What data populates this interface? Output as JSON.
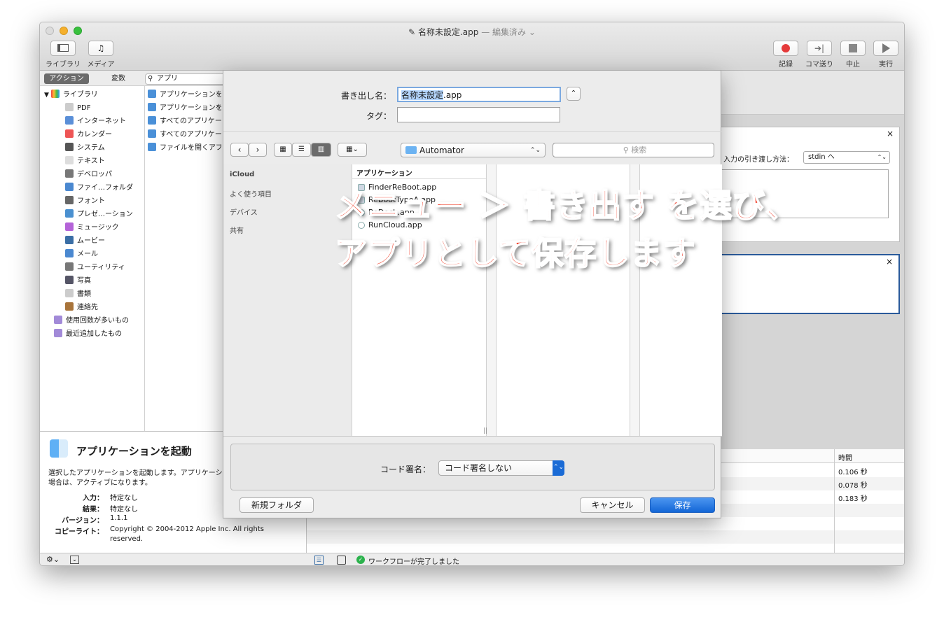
{
  "window": {
    "title": "名称未設定.app",
    "subtitle": "— 編集済み ⌄"
  },
  "toolbar": {
    "library": "ライブラリ",
    "media": "メディア",
    "record": "記録",
    "step": "コマ送り",
    "stop": "中止",
    "run": "実行"
  },
  "lib_tabs": {
    "actions": "アクション",
    "variables": "変数",
    "search": "アプリ"
  },
  "library": {
    "root": "ライブラリ",
    "items": [
      "PDF",
      "インターネット",
      "カレンダー",
      "システム",
      "テキスト",
      "デベロッパ",
      "ファイ…フォルダ",
      "フォント",
      "プレゼ…ーション",
      "ミュージック",
      "ムービー",
      "メール",
      "ユーティリティ",
      "写真",
      "書類",
      "連絡先"
    ],
    "smart": [
      "使用回数が多いもの",
      "最近追加したもの"
    ]
  },
  "actions": [
    "アプリケーションを",
    "アプリケーションを",
    "すべてのアプリケー",
    "すべてのアプリケー",
    "ファイルを開くアプ"
  ],
  "description": {
    "title": "アプリケーションを起動",
    "body1": "選択したアプリケーションを起動します。アプリケーシ",
    "body2": "場合は、アクティブになります。",
    "input_label": "入力：",
    "input": "特定なし",
    "result_label": "結果：",
    "result": "特定なし",
    "version_label": "バージョン：",
    "version": "1.1.1",
    "copyright_label": "コピーライト：",
    "copyright1": "Copyright © 2004-2012 Apple Inc.  All rights",
    "copyright2": "reserved."
  },
  "action_card": {
    "pass_label": "入力の引き渡し方法：",
    "pass_value": "stdin へ"
  },
  "log": {
    "time_header": "時間",
    "times": [
      "0.106 秒",
      "0.078 秒",
      "0.183 秒"
    ],
    "status": "ワークフローが完了しました"
  },
  "sheet": {
    "export_label": "書き出し名：",
    "export_selected": "名称未設定",
    "export_ext": ".app",
    "tag_label": "タグ：",
    "location": "Automator",
    "search_placeholder": "検索",
    "sidebar": [
      "iCloud",
      "よく使う項目",
      "デバイス",
      "共有"
    ],
    "col_header": "アプリケーション",
    "files": [
      "FinderReBoot.app",
      "ReBootTypeA.app",
      "ReDock.app",
      "RunCloud.app"
    ],
    "sign_label": "コード署名：",
    "sign_value": "コード署名しない",
    "new_folder": "新規フォルダ",
    "cancel": "キャンセル",
    "save": "保存"
  },
  "overlay": {
    "line1": "メニュー ＞ 書き出す を選び、",
    "line2": "アプリとして保存します"
  },
  "colors": {
    "accent": "#1a6bd6",
    "overlay": "#f0351f"
  }
}
